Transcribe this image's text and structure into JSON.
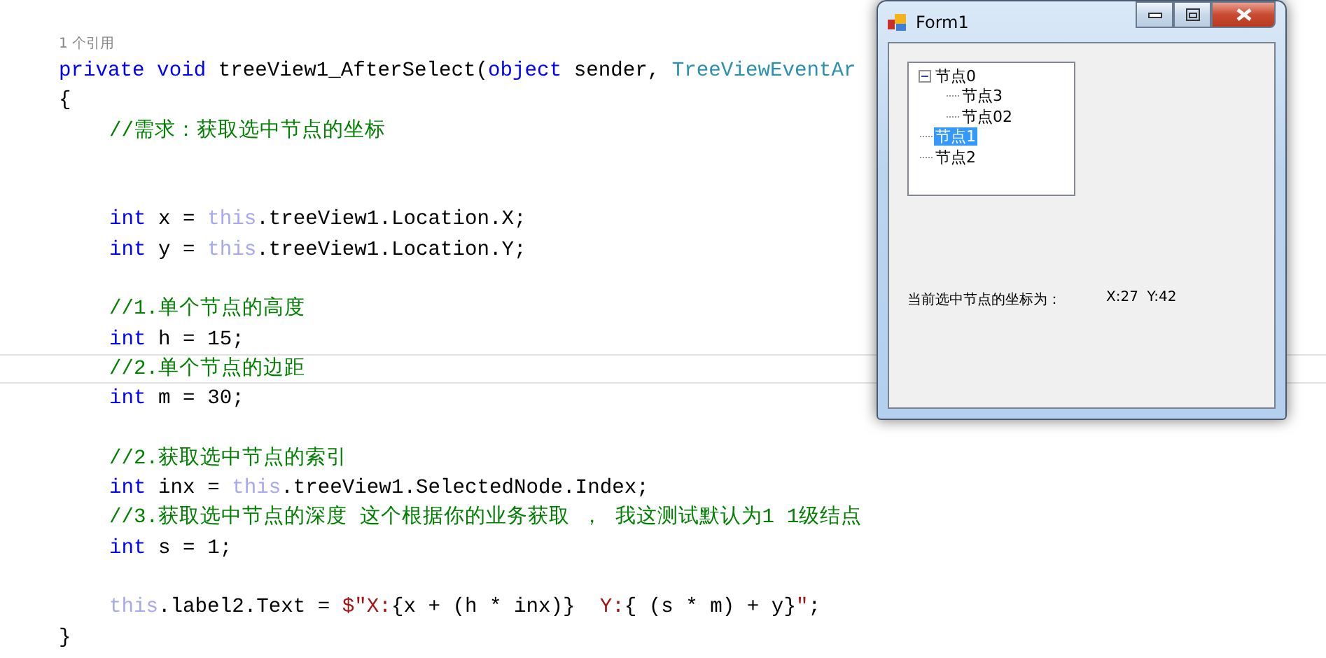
{
  "editor": {
    "codelens": "1 个引用",
    "lines": [
      {
        "indented": false,
        "current": false,
        "tokens": [
          {
            "kind": "keyword",
            "text": "private void"
          },
          {
            "kind": "plain",
            "text": " treeView1_AfterSelect("
          },
          {
            "kind": "keyword",
            "text": "object"
          },
          {
            "kind": "plain",
            "text": " sender, "
          },
          {
            "kind": "type",
            "text": "TreeViewEventAr"
          }
        ]
      },
      {
        "indented": false,
        "current": false,
        "tokens": [
          {
            "kind": "plain",
            "text": "{"
          }
        ]
      },
      {
        "indented": true,
        "current": false,
        "tokens": [
          {
            "kind": "comment",
            "text": "//需求：获取选中节点的坐标"
          }
        ]
      },
      {
        "current": false
      },
      {
        "current": false
      },
      {
        "indented": true,
        "current": false,
        "tokens": [
          {
            "kind": "keyword",
            "text": "int"
          },
          {
            "kind": "plain",
            "text": " x = "
          },
          {
            "kind": "this",
            "text": "this"
          },
          {
            "kind": "plain",
            "text": ".treeView1.Location.X;"
          }
        ]
      },
      {
        "indented": true,
        "current": false,
        "tokens": [
          {
            "kind": "keyword",
            "text": "int"
          },
          {
            "kind": "plain",
            "text": " y = "
          },
          {
            "kind": "this",
            "text": "this"
          },
          {
            "kind": "plain",
            "text": ".treeView1.Location.Y;"
          }
        ]
      },
      {
        "current": false
      },
      {
        "indented": true,
        "current": false,
        "tokens": [
          {
            "kind": "comment",
            "text": "//1.单个节点的高度"
          }
        ]
      },
      {
        "indented": true,
        "current": false,
        "tokens": [
          {
            "kind": "keyword",
            "text": "int"
          },
          {
            "kind": "plain",
            "text": " h = 15;"
          }
        ]
      },
      {
        "indented": true,
        "current": true,
        "tokens": [
          {
            "kind": "comment",
            "text": "//2.单个节点的边距"
          }
        ]
      },
      {
        "indented": true,
        "current": false,
        "tokens": [
          {
            "kind": "keyword",
            "text": "int"
          },
          {
            "kind": "plain",
            "text": " m = 30;"
          }
        ]
      },
      {
        "current": false
      },
      {
        "indented": true,
        "current": false,
        "tokens": [
          {
            "kind": "comment",
            "text": "//2.获取选中节点的索引"
          }
        ]
      },
      {
        "indented": true,
        "current": false,
        "tokens": [
          {
            "kind": "keyword",
            "text": "int"
          },
          {
            "kind": "plain",
            "text": " inx = "
          },
          {
            "kind": "this",
            "text": "this"
          },
          {
            "kind": "plain",
            "text": ".treeView1.SelectedNode.Index;"
          }
        ]
      },
      {
        "indented": true,
        "current": false,
        "tokens": [
          {
            "kind": "comment",
            "text": "//3.获取选中节点的深度 这个根据你的业务获取 ， 我这测试默认为1 1级结点"
          }
        ]
      },
      {
        "indented": true,
        "current": false,
        "tokens": [
          {
            "kind": "keyword",
            "text": "int"
          },
          {
            "kind": "plain",
            "text": " s = 1;"
          }
        ]
      },
      {
        "current": false
      },
      {
        "indented": true,
        "current": false,
        "tokens": [
          {
            "kind": "this",
            "text": "this"
          },
          {
            "kind": "plain",
            "text": ".label2.Text = "
          },
          {
            "kind": "string",
            "text": "$\"X:"
          },
          {
            "kind": "plain",
            "text": "{x + (h * inx)}"
          },
          {
            "kind": "string",
            "text": "  Y:"
          },
          {
            "kind": "plain",
            "text": "{ (s * m) + y}"
          },
          {
            "kind": "string",
            "text": "\""
          },
          {
            "kind": "plain",
            "text": ";"
          }
        ]
      },
      {
        "indented": false,
        "current": false,
        "tokens": [
          {
            "kind": "plain",
            "text": "}"
          }
        ]
      }
    ]
  },
  "window": {
    "title": "Form1",
    "tree": [
      {
        "label": "节点0",
        "expanded": true,
        "selected": false,
        "children": [
          {
            "label": "节点3",
            "selected": false
          },
          {
            "label": "节点02",
            "selected": false
          }
        ]
      },
      {
        "label": "节点1",
        "selected": true
      },
      {
        "label": "节点2",
        "selected": false
      }
    ],
    "label": "当前选中节点的坐标为：",
    "coordinates": "X:27  Y:42"
  }
}
